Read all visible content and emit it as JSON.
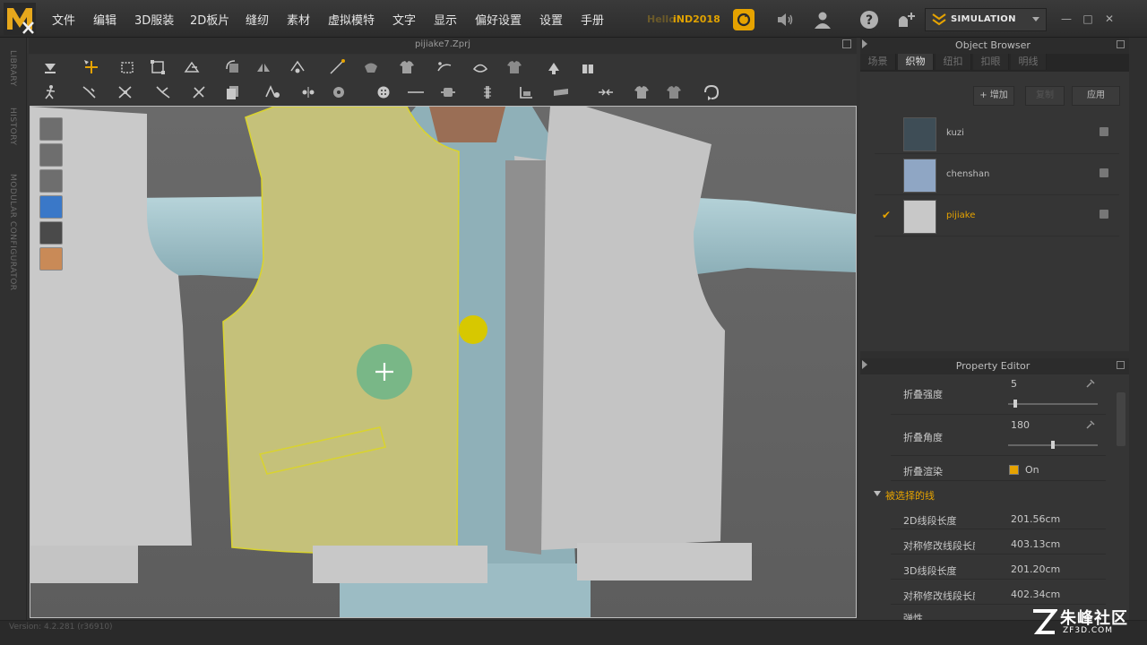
{
  "menu": [
    "文件",
    "编辑",
    "3D服装",
    "2D板片",
    "缝纫",
    "素材",
    "虚拟模特",
    "文字",
    "显示",
    "偏好设置",
    "设置",
    "手册"
  ],
  "header": {
    "greeting": "Hello",
    "username": "iND2018",
    "simulation_label": "SIMULATION"
  },
  "left_tabs": [
    "LIBRARY",
    "HISTORY",
    "MODULAR CONFIGURATOR"
  ],
  "document": {
    "title": "pijiake7.Zprj"
  },
  "object_browser": {
    "title": "Object Browser",
    "tabs": [
      "场景",
      "织物",
      "纽扣",
      "扣眼",
      "明线"
    ],
    "active_tab_index": 1,
    "add_label": "+ 增加",
    "copy_label": "复制",
    "apply_label": "应用",
    "fabrics": [
      {
        "name": "kuzi",
        "color": "#3e4d56",
        "selected": false
      },
      {
        "name": "chenshan",
        "color": "#8fa6c4",
        "selected": true
      },
      {
        "name": "pijiake",
        "color": "#c8c8c8",
        "selected": true
      }
    ]
  },
  "property_editor": {
    "title": "Property Editor",
    "fold_strength_label": "折叠强度",
    "fold_strength_value": "5",
    "fold_strength_fraction": 0.06,
    "fold_angle_label": "折叠角度",
    "fold_angle_value": "180",
    "fold_angle_fraction": 0.5,
    "fold_render_label": "折叠渲染",
    "fold_render_value": "On",
    "section_title": "被选择的线",
    "rows": [
      {
        "label": "2D线段长度",
        "value": "201.56cm"
      },
      {
        "label": "对称修改线段长度",
        "value": "403.13cm"
      },
      {
        "label": "3D线段长度",
        "value": "201.20cm"
      },
      {
        "label": "对称修改线段长度",
        "value": "402.34cm"
      },
      {
        "label": "弹性",
        "value": ""
      }
    ]
  },
  "status": {
    "version": "Version: 4.2.281 (r36910)"
  },
  "watermark": {
    "text": "朱峰社区",
    "url": "ZF3D.COM"
  }
}
